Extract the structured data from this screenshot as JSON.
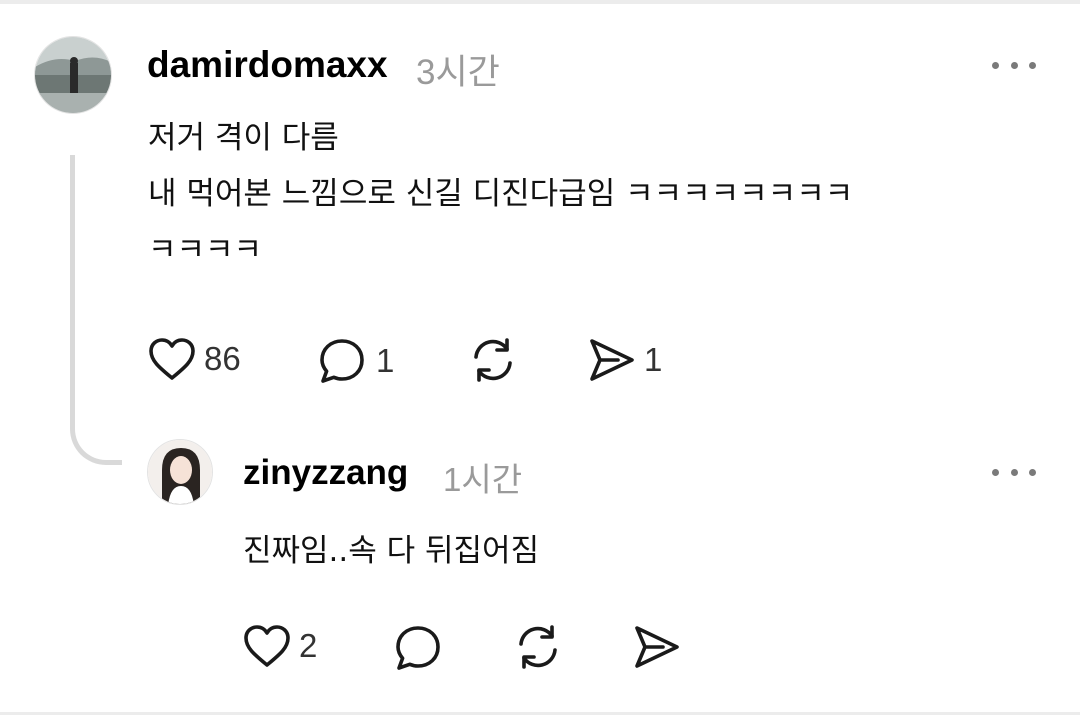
{
  "post": {
    "username": "damirdomaxx",
    "time": "3시간",
    "lines": [
      "저거 격이 다름",
      "내 먹어본 느낌으로 신길 디진다급임 ㅋㅋㅋㅋㅋㅋㅋㅋ",
      "ㅋㅋㅋㅋ"
    ],
    "likes": "86",
    "replies": "1",
    "reposts": "",
    "shares": "1"
  },
  "reply": {
    "username": "zinyzzang",
    "time": "1시간",
    "lines": [
      "진짜임..속 다 뒤집어짐"
    ],
    "likes": "2",
    "replies": "",
    "reposts": "",
    "shares": ""
  },
  "icons": {
    "like": "heart-icon",
    "reply": "comment-bubble-icon",
    "repost": "repost-arrows-icon",
    "share": "send-paper-plane-icon",
    "more": "more-dots-icon"
  },
  "colors": {
    "icon": "#1a1a1a",
    "muted": "#9a9a9a",
    "thread_line": "#d9d9d9"
  }
}
